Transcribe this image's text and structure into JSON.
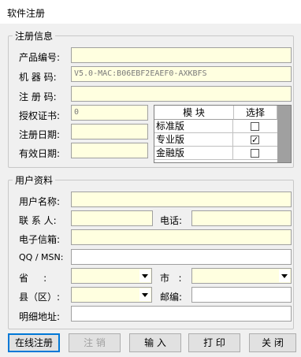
{
  "window": {
    "title": "软件注册"
  },
  "register_info": {
    "legend": "注册信息",
    "product_no_label": "产品编号:",
    "product_no_value": "",
    "machine_code_label": "机 器 码:",
    "machine_code_value": "V5.0-MAC:B06EBF2EAEF0-AXKBFS",
    "reg_code_label": "注 册 码:",
    "reg_code_value": "",
    "license_label": "授权证书:",
    "license_value": "0",
    "reg_date_label": "注册日期:",
    "reg_date_value": "",
    "valid_date_label": "有效日期:",
    "valid_date_value": "",
    "modules": {
      "header_module": "模  块",
      "header_select": "选择",
      "rows": [
        {
          "name": "标准版",
          "checked": false,
          "check_glyph": ""
        },
        {
          "name": "专业版",
          "checked": true,
          "check_glyph": "✓"
        },
        {
          "name": "金融版",
          "checked": false,
          "check_glyph": ""
        }
      ]
    }
  },
  "user_info": {
    "legend": "用户资料",
    "user_name_label": "用户名称:",
    "user_name_value": "",
    "contact_label": "联 系 人:",
    "contact_value": "",
    "phone_label": "电话:",
    "phone_value": "",
    "email_label": "电子信箱:",
    "email_value": "",
    "qq_label": "QQ / MSN:",
    "qq_value": "",
    "province_label": "省     :",
    "province_value": "",
    "city_label": "市   :",
    "city_value": "",
    "county_label": "县（区）:",
    "county_value": "",
    "postcode_label": "邮编:",
    "postcode_value": "",
    "address_label": "明细地址:",
    "address_value": ""
  },
  "buttons": {
    "online_register": "在线注册",
    "unregister": "注 销",
    "import": "输 入",
    "print": "打 印",
    "close": "关 闭"
  },
  "colors": {
    "field_bg": "#ffffe0",
    "window_bg": "#f0f0f0",
    "focus_border": "#0078d7"
  }
}
